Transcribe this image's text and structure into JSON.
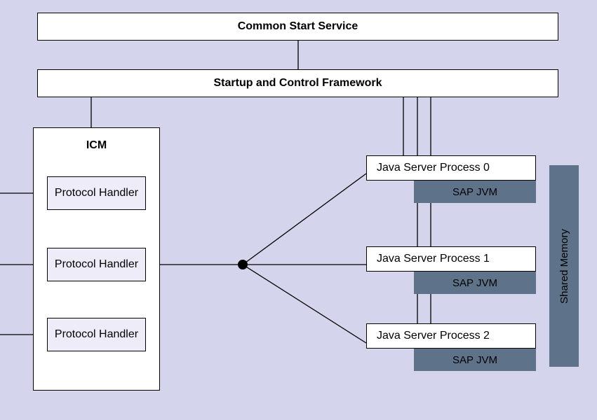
{
  "nodes": {
    "common_start": "Common Start Service",
    "startup": "Startup and Control Framework",
    "icm": "ICM",
    "protocol_handler_1": "Protocol Handler",
    "protocol_handler_2": "Protocol Handler",
    "protocol_handler_3": "Protocol Handler",
    "jsp0": "Java Server Process 0",
    "jsp1": "Java Server Process 1",
    "jsp2": "Java Server Process 2",
    "jvm0": "SAP JVM",
    "jvm1": "SAP JVM",
    "jvm2": "SAP JVM",
    "shared_memory": "Shared Memory"
  }
}
